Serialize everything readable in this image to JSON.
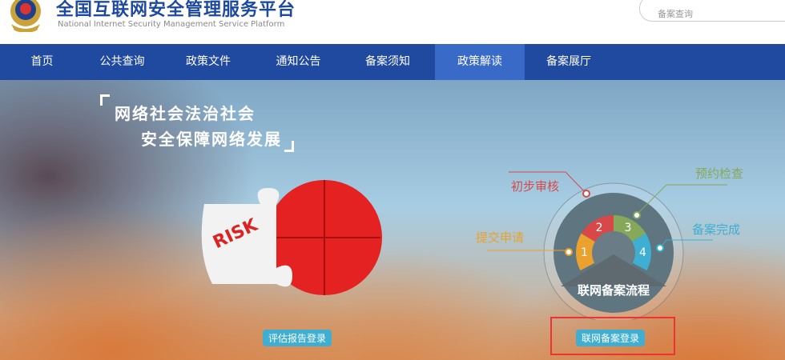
{
  "header": {
    "title": "全国互联网安全管理服务平台",
    "subtitle": "National Internet Security Management Service Platform",
    "search_placeholder": "备案查询"
  },
  "nav": {
    "items": [
      {
        "label": "首页"
      },
      {
        "label": "公共查询"
      },
      {
        "label": "政策文件"
      },
      {
        "label": "通知公告"
      },
      {
        "label": "备案须知"
      },
      {
        "label": "政策解读",
        "active": true
      },
      {
        "label": "备案展厅"
      }
    ]
  },
  "banner": {
    "slogan_line1": "网络社会法治社会",
    "slogan_line2": "安全保障网络发展",
    "risk_text": "RISK",
    "risk_button": "评估报告登录",
    "process": {
      "center_label": "联网备案流程",
      "steps": [
        {
          "num": "1",
          "label": "提交申请",
          "color": "#eaa12e"
        },
        {
          "num": "2",
          "label": "初步审核",
          "color": "#d84848"
        },
        {
          "num": "3",
          "label": "预约检查",
          "color": "#86a85a"
        },
        {
          "num": "4",
          "label": "备案完成",
          "color": "#3eaed2"
        }
      ]
    },
    "filing_button": "联网备案登录"
  }
}
